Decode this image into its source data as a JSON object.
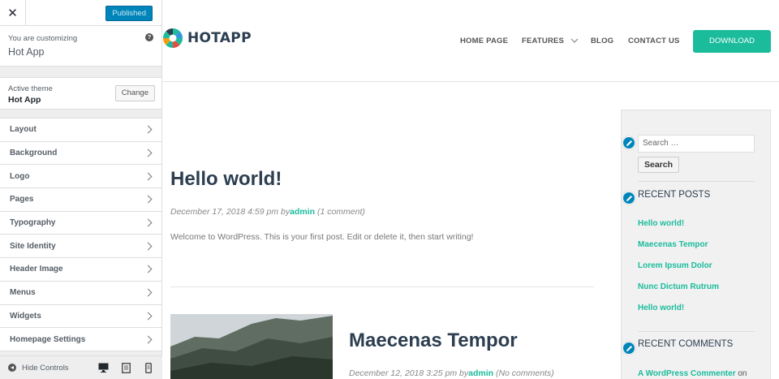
{
  "customizer": {
    "close_label": "✕",
    "published_label": "Published",
    "customizing_label": "You are customizing",
    "site_name": "Hot App",
    "help_label": "?",
    "active_theme_label": "Active theme",
    "theme_name": "Hot App",
    "change_label": "Change",
    "sections": [
      "Layout",
      "Background",
      "Logo",
      "Pages",
      "Typography",
      "Site Identity",
      "Header Image",
      "Menus",
      "Widgets",
      "Homepage Settings"
    ],
    "hide_controls_label": "Hide Controls"
  },
  "site": {
    "logo_text": "HOTAPP",
    "nav": {
      "home": "HOME PAGE",
      "features": "FEATURES",
      "blog": "BLOG",
      "contact": "CONTACT US"
    },
    "download_label": "DOWNLOAD",
    "posts": [
      {
        "title": "Hello world!",
        "date": "December 17, 2018 4:59 pm",
        "by": "by",
        "author": "admin",
        "comments": "(1 comment)",
        "excerpt": "Welcome to WordPress. This is your first post. Edit or delete it, then start writing!"
      },
      {
        "title": "Maecenas Tempor",
        "date": "December 12, 2018 3:25 pm",
        "by": "by",
        "author": "admin",
        "comments": "(No comments)"
      }
    ],
    "sidebar": {
      "search_placeholder": "Search …",
      "search_button": "Search",
      "recent_posts_title": "RECENT POSTS",
      "recent_posts": [
        "Hello world!",
        "Maecenas Tempor",
        "Lorem Ipsum Dolor",
        "Nunc Dictum Rutrum",
        "Hello world!"
      ],
      "recent_comments_title": "RECENT COMMENTS",
      "recent_comment_author": "A WordPress Commenter",
      "recent_comment_on": "on"
    }
  },
  "colors": {
    "accent": "#1abc9c",
    "wp_blue": "#0085ba",
    "heading": "#2c3e50"
  }
}
